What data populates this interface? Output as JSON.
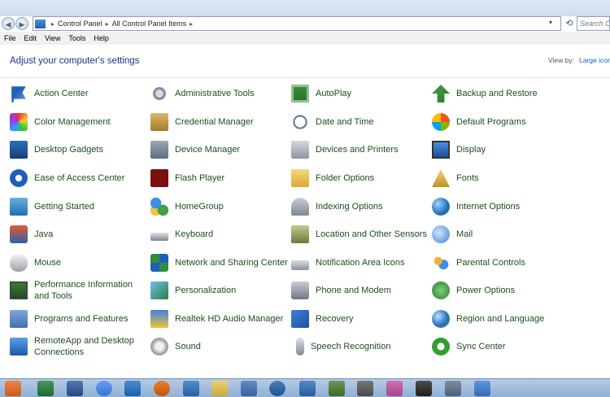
{
  "address": {
    "crumbs": [
      "Control Panel",
      "All Control Panel Items"
    ],
    "search_placeholder": "Search Co"
  },
  "menu": [
    "File",
    "Edit",
    "View",
    "Tools",
    "Help"
  ],
  "header": {
    "title": "Adjust your computer's settings",
    "view_by_label": "View by:",
    "view_by_value": "Large icons"
  },
  "items": [
    {
      "label": "Action Center",
      "icon": "flag-icon"
    },
    {
      "label": "Administrative Tools",
      "icon": "admin-tools-icon"
    },
    {
      "label": "AutoPlay",
      "icon": "autoplay-icon"
    },
    {
      "label": "Backup and Restore",
      "icon": "backup-icon"
    },
    {
      "label": "Color Management",
      "icon": "color-management-icon"
    },
    {
      "label": "Credential Manager",
      "icon": "credential-icon"
    },
    {
      "label": "Date and Time",
      "icon": "clock-icon"
    },
    {
      "label": "Default Programs",
      "icon": "default-programs-icon"
    },
    {
      "label": "Desktop Gadgets",
      "icon": "gadgets-icon"
    },
    {
      "label": "Device Manager",
      "icon": "device-manager-icon"
    },
    {
      "label": "Devices and Printers",
      "icon": "printer-icon"
    },
    {
      "label": "Display",
      "icon": "display-icon"
    },
    {
      "label": "Ease of Access Center",
      "icon": "ease-of-access-icon"
    },
    {
      "label": "Flash Player",
      "icon": "flash-icon"
    },
    {
      "label": "Folder Options",
      "icon": "folder-icon"
    },
    {
      "label": "Fonts",
      "icon": "fonts-icon"
    },
    {
      "label": "Getting Started",
      "icon": "getting-started-icon"
    },
    {
      "label": "HomeGroup",
      "icon": "homegroup-icon"
    },
    {
      "label": "Indexing Options",
      "icon": "indexing-icon"
    },
    {
      "label": "Internet Options",
      "icon": "globe-icon"
    },
    {
      "label": "Java",
      "icon": "java-icon"
    },
    {
      "label": "Keyboard",
      "icon": "keyboard-icon"
    },
    {
      "label": "Location and Other Sensors",
      "icon": "location-icon"
    },
    {
      "label": "Mail",
      "icon": "mail-icon"
    },
    {
      "label": "Mouse",
      "icon": "mouse-icon"
    },
    {
      "label": "Network and Sharing Center",
      "icon": "network-icon"
    },
    {
      "label": "Notification Area Icons",
      "icon": "notification-icon"
    },
    {
      "label": "Parental Controls",
      "icon": "parental-icon"
    },
    {
      "label": "Performance Information and Tools",
      "icon": "performance-icon"
    },
    {
      "label": "Personalization",
      "icon": "personalization-icon"
    },
    {
      "label": "Phone and Modem",
      "icon": "phone-icon"
    },
    {
      "label": "Power Options",
      "icon": "power-icon"
    },
    {
      "label": "Programs and Features",
      "icon": "programs-icon"
    },
    {
      "label": "Realtek HD Audio Manager",
      "icon": "audio-manager-icon"
    },
    {
      "label": "Recovery",
      "icon": "recovery-icon"
    },
    {
      "label": "Region and Language",
      "icon": "region-icon"
    },
    {
      "label": "RemoteApp and Desktop Connections",
      "icon": "remoteapp-icon"
    },
    {
      "label": "Sound",
      "icon": "speaker-icon"
    },
    {
      "label": "Speech Recognition",
      "icon": "microphone-icon"
    },
    {
      "label": "Sync Center",
      "icon": "sync-icon"
    }
  ],
  "taskbar": [
    {
      "name": "media-player-icon",
      "color": "#e8681c"
    },
    {
      "name": "excel-icon",
      "color": "#1e7a3c"
    },
    {
      "name": "word-icon",
      "color": "#2a5699"
    },
    {
      "name": "chrome-icon",
      "color": "#4285f4"
    },
    {
      "name": "outlook-icon",
      "color": "#1e6fc1"
    },
    {
      "name": "firefox-icon",
      "color": "#e66000"
    },
    {
      "name": "thunderbird-icon",
      "color": "#2a6fb8"
    },
    {
      "name": "explorer-icon",
      "color": "#e8c34a"
    },
    {
      "name": "network-share-icon",
      "color": "#3f6fb5"
    },
    {
      "name": "malwarebytes-icon",
      "color": "#1f5fa8"
    },
    {
      "name": "refresh-app-icon",
      "color": "#2c6bb5"
    },
    {
      "name": "game-icon",
      "color": "#4b7a2a"
    },
    {
      "name": "network-monitor-icon",
      "color": "#555555"
    },
    {
      "name": "paint-icon",
      "color": "#c04fa0"
    },
    {
      "name": "cmd-icon",
      "color": "#222222"
    },
    {
      "name": "calculator-icon",
      "color": "#5c6f86"
    },
    {
      "name": "control-panel-icon",
      "color": "#3b7bcf"
    }
  ]
}
